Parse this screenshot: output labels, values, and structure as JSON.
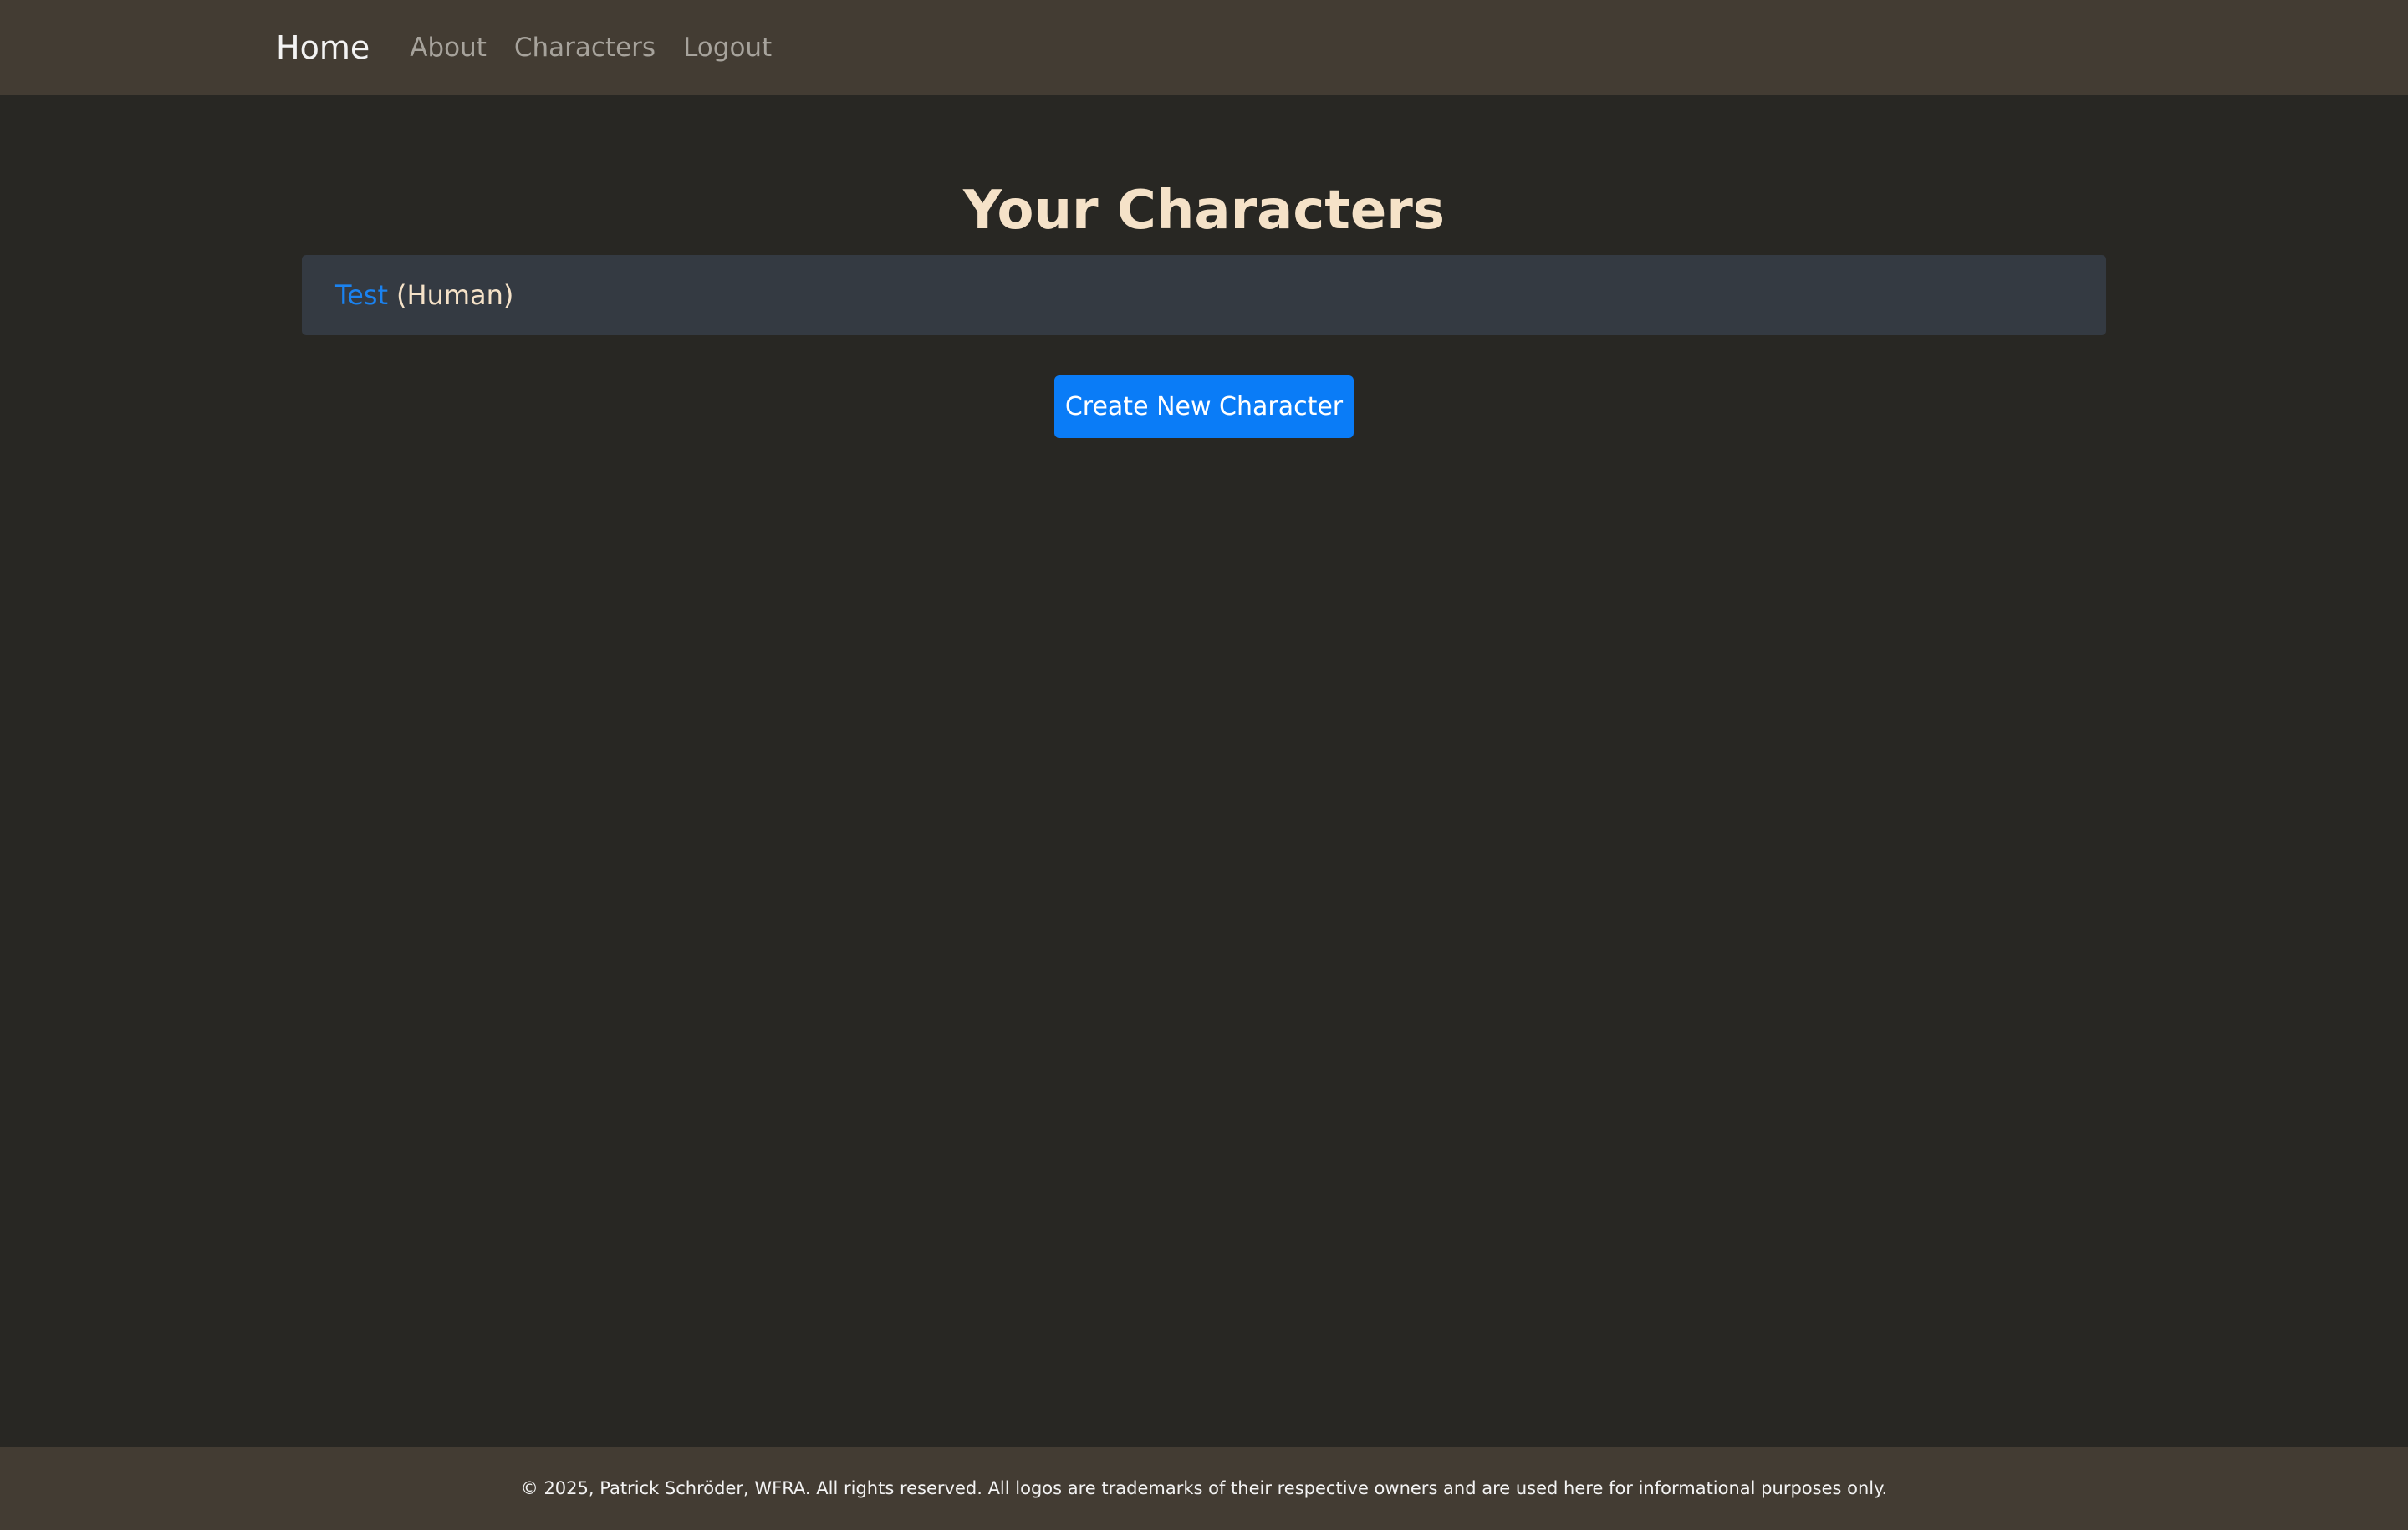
{
  "nav": {
    "brand": "Home",
    "links": [
      "About",
      "Characters",
      "Logout"
    ]
  },
  "main": {
    "title": "Your Characters",
    "characters": [
      {
        "name": "Test",
        "race": "(Human)"
      }
    ],
    "create_button_label": "Create New Character"
  },
  "footer": {
    "text": "© 2025, Patrick Schröder, WFRA. All rights reserved. All logos are trademarks of their respective owners and are used here for informational purposes only."
  },
  "colors": {
    "navbar_bg": "#433c33",
    "page_bg": "#282723",
    "title": "#f5e2c8",
    "link_accent": "#1a82f0",
    "button_bg": "#0a7cf7",
    "card_bg": "#343a42"
  }
}
